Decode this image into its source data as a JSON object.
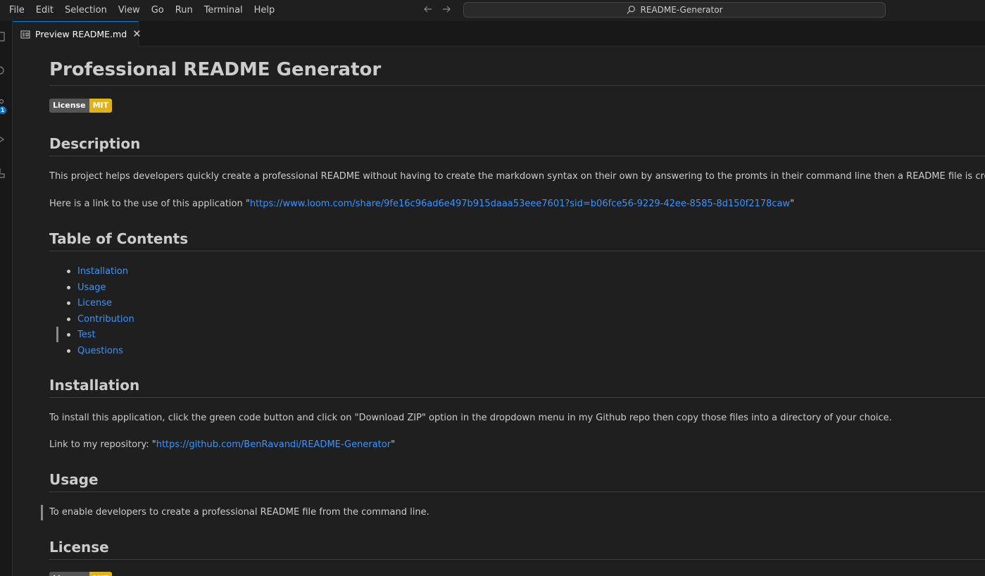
{
  "menu": [
    "File",
    "Edit",
    "Selection",
    "View",
    "Go",
    "Run",
    "Terminal",
    "Help"
  ],
  "nav": {
    "back_icon": "arrow-left-icon",
    "forward_icon": "arrow-right-icon"
  },
  "command_center": {
    "text": "README-Generator",
    "icon": "search-icon"
  },
  "activity": {
    "badge": "1"
  },
  "tab": {
    "label": "Preview README.md",
    "close": "✕"
  },
  "doc": {
    "title": "Professional README Generator",
    "badge": {
      "left": "License",
      "right": "MIT"
    },
    "description_heading": "Description",
    "description_text": "This project helps developers quickly create a professional README without having to create the markdown syntax on their own by answering to the promts in their command line then a README file is created for them",
    "link_line_prefix": "Here is a link to the use of this application \"",
    "link_line_url": "https://www.loom.com/share/9fe16c96ad6e497b915daaa53eee7601?sid=b06fce56-9229-42ee-8585-8d150f2178caw",
    "link_line_suffix": "\"",
    "toc_heading": "Table of Contents",
    "toc": [
      "Installation",
      "Usage",
      "License",
      "Contribution",
      "Test",
      "Questions"
    ],
    "installation_heading": "Installation",
    "installation_text": "To install this application, click the green code button and click on \"Download ZIP\" option in the dropdown menu in my Github repo then copy those files into a directory of your choice.",
    "repo_prefix": "Link to my repository: \"",
    "repo_url": "https://github.com/BenRavandi/README-Generator",
    "repo_suffix": "\"",
    "usage_heading": "Usage",
    "usage_text": "To enable developers to create a professional README file from the command line.",
    "license_heading": "License"
  },
  "colors": {
    "link": "#3794ff",
    "badge_left": "#555555",
    "badge_right": "#dfb317",
    "accent": "#0078d4"
  }
}
